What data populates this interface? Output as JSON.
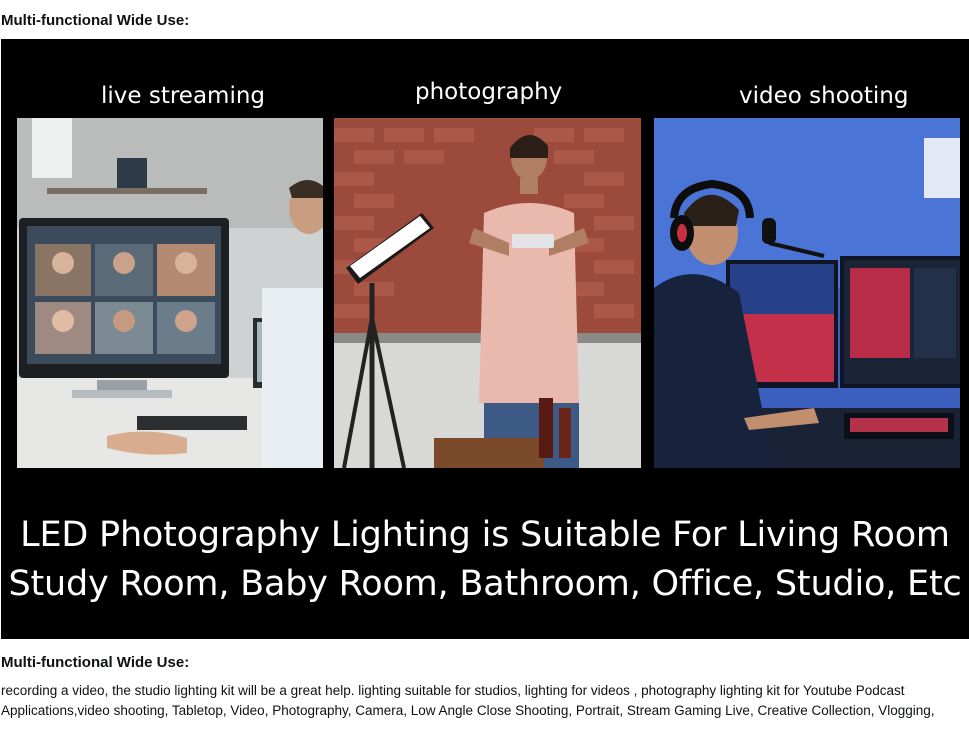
{
  "heading_top": "Multi-functional Wide Use:",
  "banner": {
    "panels": [
      {
        "label": "live streaming",
        "icon": "video-conference-photo"
      },
      {
        "label": "photography",
        "icon": "woman-photographing-photo"
      },
      {
        "label": "video shooting",
        "icon": "gamer-streaming-photo"
      }
    ],
    "caption_line1": "LED Photography Lighting is Suitable For Living Room",
    "caption_line2": "Study Room, Baby Room, Bathroom, Office, Studio, Etc"
  },
  "heading_bottom": "Multi-functional Wide Use:",
  "description": "recording a video, the studio lighting kit will be a great help. lighting suitable for studios, lighting for videos , photography lighting kit for Youtube Podcast Applications,video shooting, Tabletop, Video, Photography, Camera, Low Angle Close Shooting, Portrait, Stream Gaming Live, Creative Collection, Vlogging,",
  "colors": {
    "banner_bg": "#000000",
    "text": "#0f1111",
    "caption": "#ffffff"
  }
}
